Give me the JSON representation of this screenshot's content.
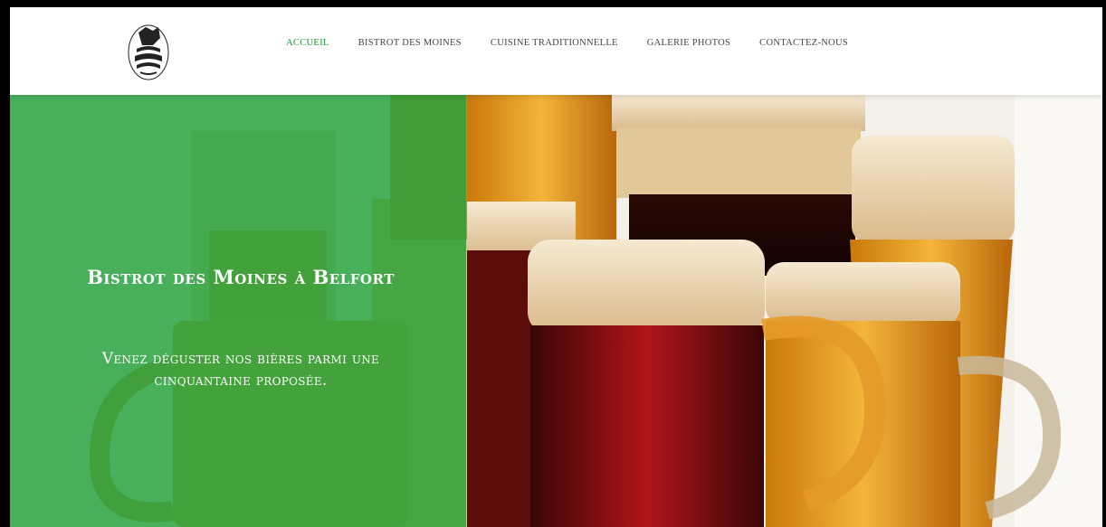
{
  "brand": {
    "logo_icon": "monk-bistrot-logo-icon"
  },
  "nav": {
    "items": [
      {
        "label": "ACCUEIL",
        "active": true
      },
      {
        "label": "BISTROT DES MOINES",
        "active": false
      },
      {
        "label": "CUISINE TRADITIONNELLE",
        "active": false
      },
      {
        "label": "GALERIE PHOTOS",
        "active": false
      },
      {
        "label": "CONTACTEZ-NOUS",
        "active": false
      }
    ],
    "active_color": "#1e9a3b"
  },
  "hero": {
    "title": "Bistrot des Moines à Belfort",
    "subtitle": "Venez déguster nos bières parmi une cinquantaine proposée.",
    "overlay_color": "#22a03c"
  }
}
